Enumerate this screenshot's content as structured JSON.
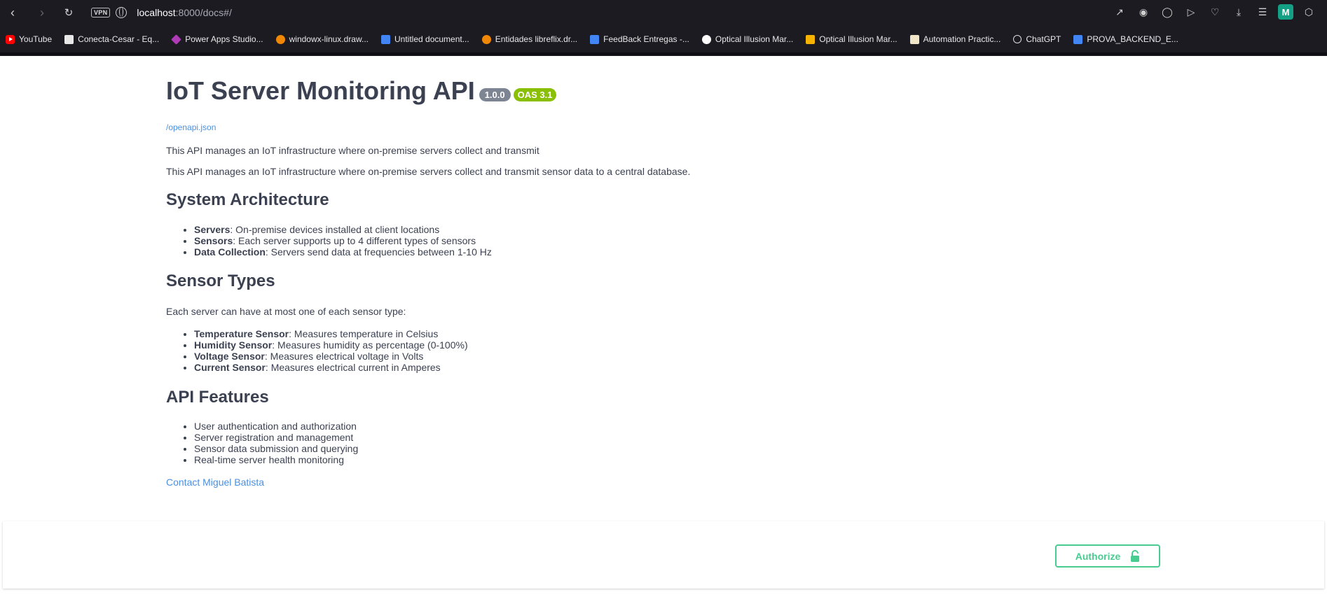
{
  "browser": {
    "url_host": "localhost",
    "url_path": ":8000/docs#/",
    "vpn_label": "VPN",
    "avatar_letter": "M",
    "bookmarks": [
      {
        "label": "YouTube",
        "icon": "youtube-icon"
      },
      {
        "label": "Conecta-Cesar - Eq...",
        "icon": "file-icon"
      },
      {
        "label": "Power Apps Studio...",
        "icon": "power-apps-icon"
      },
      {
        "label": "windowx-linux.draw...",
        "icon": "drawio-icon"
      },
      {
        "label": "Untitled document...",
        "icon": "google-docs-icon"
      },
      {
        "label": "Entidades libreflix.dr...",
        "icon": "drawio-icon"
      },
      {
        "label": "FeedBack Entregas -...",
        "icon": "google-docs-icon"
      },
      {
        "label": "Optical Illusion Mar...",
        "icon": "google-icon"
      },
      {
        "label": "Optical Illusion Mar...",
        "icon": "google-slides-icon"
      },
      {
        "label": "Automation Practic...",
        "icon": "automation-icon"
      },
      {
        "label": "ChatGPT",
        "icon": "chatgpt-icon"
      },
      {
        "label": "PROVA_BACKEND_E...",
        "icon": "google-docs-icon"
      }
    ]
  },
  "info": {
    "title": "IoT Server Monitoring API",
    "version": "1.0.0",
    "oas_version": "OAS 3.1",
    "openapi_link": "/openapi.json",
    "summary": "This API manages an IoT infrastructure where on-premise servers collect and transmit",
    "description": "This API manages an IoT infrastructure where on-premise servers collect and transmit sensor data to a central database.",
    "sections": {
      "architecture": {
        "heading": "System Architecture",
        "items": [
          {
            "term": "Servers",
            "text": ": On-premise devices installed at client locations"
          },
          {
            "term": "Sensors",
            "text": ": Each server supports up to 4 different types of sensors"
          },
          {
            "term": "Data Collection",
            "text": ": Servers send data at frequencies between 1-10 Hz"
          }
        ]
      },
      "sensor_types": {
        "heading": "Sensor Types",
        "intro": "Each server can have at most one of each sensor type:",
        "items": [
          {
            "term": "Temperature Sensor",
            "text": ": Measures temperature in Celsius"
          },
          {
            "term": "Humidity Sensor",
            "text": ": Measures humidity as percentage (0-100%)"
          },
          {
            "term": "Voltage Sensor",
            "text": ": Measures electrical voltage in Volts"
          },
          {
            "term": "Current Sensor",
            "text": ": Measures electrical current in Amperes"
          }
        ]
      },
      "features": {
        "heading": "API Features",
        "items": [
          "User authentication and authorization",
          "Server registration and management",
          "Sensor data submission and querying",
          "Real-time server health monitoring"
        ]
      }
    },
    "contact_label": "Contact Miguel Batista"
  },
  "auth": {
    "authorize_label": "Authorize"
  },
  "colors": {
    "text": "#3b4151",
    "link": "#4990e2",
    "version_badge": "#7d8492",
    "oas_badge": "#89bf04",
    "authorize": "#49cc90",
    "chrome_bg": "#1c1b22"
  }
}
